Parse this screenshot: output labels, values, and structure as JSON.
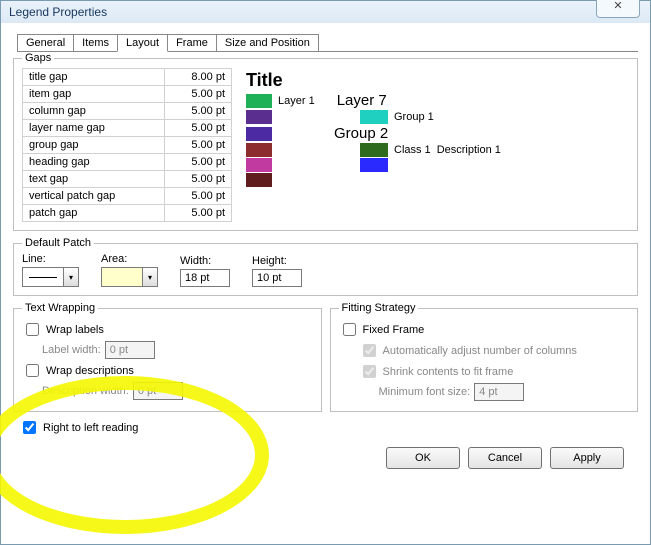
{
  "title": "Legend Properties",
  "closeGlyph": "✕",
  "tabs": {
    "general": "General",
    "items": "Items",
    "layout": "Layout",
    "frame": "Frame",
    "size": "Size and Position"
  },
  "gaps": {
    "legend": "Gaps",
    "rows": [
      {
        "name": "title gap",
        "value": "8.00 pt"
      },
      {
        "name": "item gap",
        "value": "5.00 pt"
      },
      {
        "name": "column gap",
        "value": "5.00 pt"
      },
      {
        "name": "layer name gap",
        "value": "5.00 pt"
      },
      {
        "name": "group gap",
        "value": "5.00 pt"
      },
      {
        "name": "heading gap",
        "value": "5.00 pt"
      },
      {
        "name": "text gap",
        "value": "5.00 pt"
      },
      {
        "name": "vertical patch gap",
        "value": "5.00 pt"
      },
      {
        "name": "patch gap",
        "value": "5.00 pt"
      }
    ]
  },
  "preview": {
    "title": "Title",
    "layer1": "Layer 1",
    "layer7": "Layer 7",
    "group1": "Group 1",
    "group2": "Group 2",
    "class1": "Class 1",
    "desc1": "Description 1",
    "colors": {
      "green": "#1fb157",
      "purple": "#5a2e8f",
      "violet": "#4b2aa3",
      "maroon": "#8e2d2d",
      "magenta": "#c13aa0",
      "darkred": "#5f1d1d",
      "teal": "#1fcfc0",
      "darkgreen": "#2e6b1f",
      "blue": "#2a2aff"
    }
  },
  "defaultPatch": {
    "legend": "Default Patch",
    "line": "Line:",
    "area": "Area:",
    "widthLbl": "Width:",
    "heightLbl": "Height:",
    "width": "18 pt",
    "height": "10 pt"
  },
  "textWrap": {
    "legend": "Text Wrapping",
    "wrapLabels": "Wrap labels",
    "labelWidth": "Label width:",
    "labelWidthVal": "0 pt",
    "wrapDesc": "Wrap descriptions",
    "descWidth": "Description width:",
    "descWidthVal": "0 pt"
  },
  "fitting": {
    "legend": "Fitting Strategy",
    "fixed": "Fixed Frame",
    "autoCols": "Automatically adjust number of columns",
    "shrink": "Shrink contents to fit frame",
    "minFont": "Minimum font size:",
    "minFontVal": "4 pt"
  },
  "rtl": "Right to left reading",
  "buttons": {
    "ok": "OK",
    "cancel": "Cancel",
    "apply": "Apply"
  }
}
